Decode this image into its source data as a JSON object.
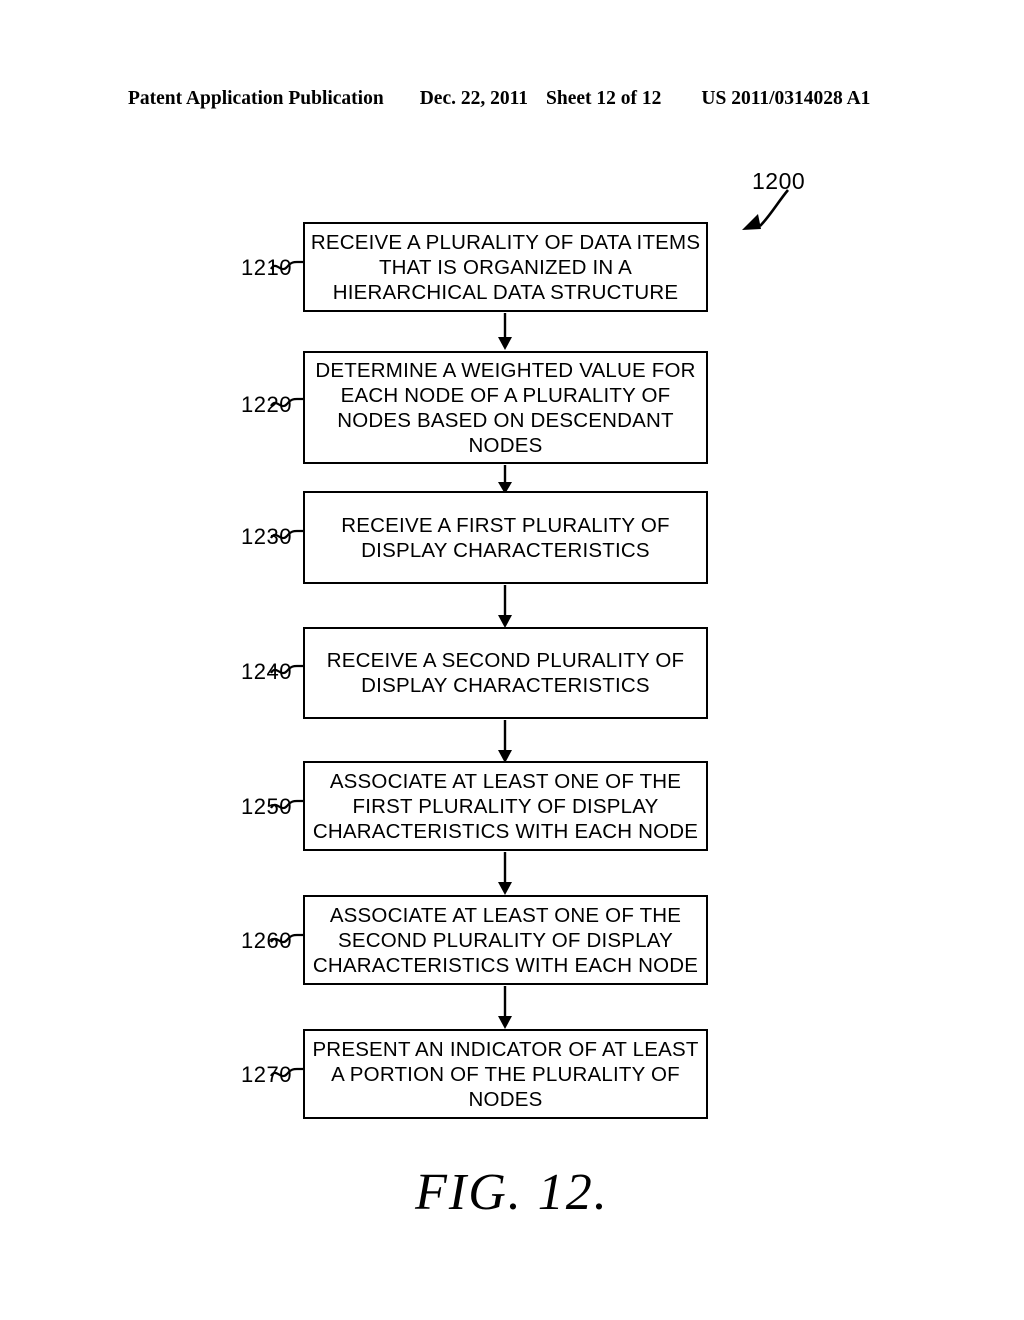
{
  "header": {
    "publication": "Patent Application Publication",
    "date": "Dec. 22, 2011",
    "sheet": "Sheet 12 of 12",
    "patent_number": "US 2011/0314028 A1"
  },
  "figure": {
    "id_label": "1200",
    "caption": "FIG. 12.",
    "id_arrow_icon": "curved-arrow-icon"
  },
  "flowchart": {
    "connector_icon": "down-arrow-icon",
    "leader_icon": "squiggle-leader-icon",
    "steps": [
      {
        "ref": "1210",
        "lines": [
          "RECEIVE A PLURALITY OF DATA ITEMS",
          "THAT IS ORGANIZED IN A",
          "HIERARCHICAL DATA STRUCTURE"
        ]
      },
      {
        "ref": "1220",
        "lines": [
          "DETERMINE A WEIGHTED VALUE FOR",
          "EACH NODE OF A PLURALITY OF",
          "NODES BASED ON DESCENDANT",
          "NODES"
        ]
      },
      {
        "ref": "1230",
        "lines": [
          "RECEIVE A FIRST PLURALITY OF",
          "DISPLAY CHARACTERISTICS"
        ]
      },
      {
        "ref": "1240",
        "lines": [
          "RECEIVE A SECOND PLURALITY OF",
          "DISPLAY CHARACTERISTICS"
        ]
      },
      {
        "ref": "1250",
        "lines": [
          "ASSOCIATE AT LEAST ONE OF THE",
          "FIRST PLURALITY OF DISPLAY",
          "CHARACTERISTICS WITH EACH NODE"
        ]
      },
      {
        "ref": "1260",
        "lines": [
          "ASSOCIATE AT LEAST ONE OF THE",
          "SECOND PLURALITY OF DISPLAY",
          "CHARACTERISTICS WITH EACH NODE"
        ]
      },
      {
        "ref": "1270",
        "lines": [
          "PRESENT AN INDICATOR OF AT LEAST",
          "A PORTION OF THE PLURALITY OF",
          "NODES"
        ]
      }
    ]
  },
  "colors": {
    "ink": "#000000",
    "paper": "#ffffff"
  }
}
